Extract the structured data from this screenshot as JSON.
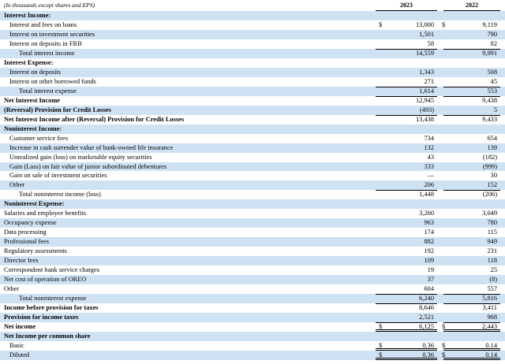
{
  "header": {
    "note": "(In thousands except shares and EPS)",
    "year_current": "2023",
    "year_prior": "2022"
  },
  "rows": [
    {
      "label": "Interest Income:",
      "v1": "",
      "v2": "",
      "indent": 0,
      "bold": true,
      "shade": true,
      "dollar": false,
      "top_rule": false,
      "bottom_rule": ""
    },
    {
      "label": "Interest and fees on loans",
      "v1": "13,000",
      "v2": "9,119",
      "indent": 1,
      "bold": false,
      "shade": false,
      "dollar": true,
      "top_rule": false,
      "bottom_rule": ""
    },
    {
      "label": "Interest on investment securities",
      "v1": "1,501",
      "v2": "790",
      "indent": 1,
      "bold": false,
      "shade": true,
      "dollar": false,
      "top_rule": false,
      "bottom_rule": ""
    },
    {
      "label": "Interest on deposits in FRB",
      "v1": "58",
      "v2": "82",
      "indent": 1,
      "bold": false,
      "shade": false,
      "dollar": false,
      "top_rule": false,
      "bottom_rule": ""
    },
    {
      "label": "Total interest income",
      "v1": "14,559",
      "v2": "9,991",
      "indent": 2,
      "bold": false,
      "shade": true,
      "dollar": false,
      "top_rule": true,
      "bottom_rule": ""
    },
    {
      "label": "Interest Expense:",
      "v1": "",
      "v2": "",
      "indent": 0,
      "bold": true,
      "shade": false,
      "dollar": false,
      "top_rule": false,
      "bottom_rule": ""
    },
    {
      "label": "Interest on deposits",
      "v1": "1,343",
      "v2": "508",
      "indent": 1,
      "bold": false,
      "shade": true,
      "dollar": false,
      "top_rule": false,
      "bottom_rule": ""
    },
    {
      "label": "Interest on other borrowed funds",
      "v1": "271",
      "v2": "45",
      "indent": 1,
      "bold": false,
      "shade": false,
      "dollar": false,
      "top_rule": false,
      "bottom_rule": ""
    },
    {
      "label": "Total interest expense",
      "v1": "1,614",
      "v2": "553",
      "indent": 2,
      "bold": false,
      "shade": true,
      "dollar": false,
      "top_rule": true,
      "bottom_rule": ""
    },
    {
      "label": "Net Interest Income",
      "v1": "12,945",
      "v2": "9,438",
      "indent": 0,
      "bold": true,
      "shade": false,
      "dollar": false,
      "top_rule": true,
      "bottom_rule": ""
    },
    {
      "label": "(Reversal) Provision for Credit Losses",
      "v1": "(493)",
      "v2": "5",
      "indent": 0,
      "bold": true,
      "shade": true,
      "dollar": false,
      "top_rule": false,
      "bottom_rule": ""
    },
    {
      "label": "Net Interest Income after (Reversal) Provision for Credit Losses",
      "v1": "13,438",
      "v2": "9,433",
      "indent": 0,
      "bold": true,
      "shade": false,
      "dollar": false,
      "top_rule": true,
      "bottom_rule": ""
    },
    {
      "label": "Noninterest Income:",
      "v1": "",
      "v2": "",
      "indent": 0,
      "bold": true,
      "shade": true,
      "dollar": false,
      "top_rule": false,
      "bottom_rule": ""
    },
    {
      "label": "Customer service fees",
      "v1": "734",
      "v2": "654",
      "indent": 1,
      "bold": false,
      "shade": false,
      "dollar": false,
      "top_rule": false,
      "bottom_rule": ""
    },
    {
      "label": "Increase in cash surrender value of bank-owned life insurance",
      "v1": "132",
      "v2": "139",
      "indent": 1,
      "bold": false,
      "shade": true,
      "dollar": false,
      "top_rule": false,
      "bottom_rule": ""
    },
    {
      "label": "Unrealized gain (loss) on marketable equity securities",
      "v1": "43",
      "v2": "(182)",
      "indent": 1,
      "bold": false,
      "shade": false,
      "dollar": false,
      "top_rule": false,
      "bottom_rule": ""
    },
    {
      "label": "Gain (Loss) on fair value of junior subordinated debentures",
      "v1": "333",
      "v2": "(999)",
      "indent": 1,
      "bold": false,
      "shade": true,
      "dollar": false,
      "top_rule": false,
      "bottom_rule": ""
    },
    {
      "label": "Gain on sale of investment securities",
      "v1": "—",
      "v2": "30",
      "indent": 1,
      "bold": false,
      "shade": false,
      "dollar": false,
      "top_rule": false,
      "bottom_rule": ""
    },
    {
      "label": "Other",
      "v1": "206",
      "v2": "152",
      "indent": 1,
      "bold": false,
      "shade": true,
      "dollar": false,
      "top_rule": false,
      "bottom_rule": ""
    },
    {
      "label": "Total noninterest income (loss)",
      "v1": "1,448",
      "v2": "(206)",
      "indent": 2,
      "bold": false,
      "shade": false,
      "dollar": false,
      "top_rule": true,
      "bottom_rule": ""
    },
    {
      "label": "Noninterest Expense:",
      "v1": "",
      "v2": "",
      "indent": 0,
      "bold": true,
      "shade": true,
      "dollar": false,
      "top_rule": false,
      "bottom_rule": ""
    },
    {
      "label": "Salaries and employee benefits",
      "v1": "3,260",
      "v2": "3,049",
      "indent": 0,
      "bold": false,
      "shade": false,
      "dollar": false,
      "top_rule": false,
      "bottom_rule": ""
    },
    {
      "label": "Occupancy expense",
      "v1": "963",
      "v2": "780",
      "indent": 0,
      "bold": false,
      "shade": true,
      "dollar": false,
      "top_rule": false,
      "bottom_rule": ""
    },
    {
      "label": "Data processing",
      "v1": "174",
      "v2": "115",
      "indent": 0,
      "bold": false,
      "shade": false,
      "dollar": false,
      "top_rule": false,
      "bottom_rule": ""
    },
    {
      "label": "Professional fees",
      "v1": "882",
      "v2": "949",
      "indent": 0,
      "bold": false,
      "shade": true,
      "dollar": false,
      "top_rule": false,
      "bottom_rule": ""
    },
    {
      "label": "Regulatory assessments",
      "v1": "192",
      "v2": "231",
      "indent": 0,
      "bold": false,
      "shade": false,
      "dollar": false,
      "top_rule": false,
      "bottom_rule": ""
    },
    {
      "label": "Director fees",
      "v1": "109",
      "v2": "118",
      "indent": 0,
      "bold": false,
      "shade": true,
      "dollar": false,
      "top_rule": false,
      "bottom_rule": ""
    },
    {
      "label": "Correspondent bank service charges",
      "v1": "19",
      "v2": "25",
      "indent": 0,
      "bold": false,
      "shade": false,
      "dollar": false,
      "top_rule": false,
      "bottom_rule": ""
    },
    {
      "label": "Net cost of operation of OREO",
      "v1": "37",
      "v2": "(8)",
      "indent": 0,
      "bold": false,
      "shade": true,
      "dollar": false,
      "top_rule": false,
      "bottom_rule": ""
    },
    {
      "label": "Other",
      "v1": "604",
      "v2": "557",
      "indent": 0,
      "bold": false,
      "shade": false,
      "dollar": false,
      "top_rule": false,
      "bottom_rule": ""
    },
    {
      "label": "Total noninterest expense",
      "v1": "6,240",
      "v2": "5,816",
      "indent": 2,
      "bold": false,
      "shade": true,
      "dollar": false,
      "top_rule": true,
      "bottom_rule": ""
    },
    {
      "label": "Income before provision for taxes",
      "v1": "8,646",
      "v2": "3,411",
      "indent": 0,
      "bold": true,
      "shade": false,
      "dollar": false,
      "top_rule": true,
      "bottom_rule": ""
    },
    {
      "label": "Provision for income taxes",
      "v1": "2,521",
      "v2": "968",
      "indent": 0,
      "bold": true,
      "shade": true,
      "dollar": false,
      "top_rule": false,
      "bottom_rule": ""
    },
    {
      "label": "Net income",
      "v1": "6,125",
      "v2": "2,443",
      "indent": 0,
      "bold": true,
      "shade": false,
      "dollar": true,
      "top_rule": true,
      "bottom_rule": "double"
    },
    {
      "label": "Net Income per common share",
      "v1": "",
      "v2": "",
      "indent": 0,
      "bold": true,
      "shade": true,
      "dollar": false,
      "top_rule": false,
      "bottom_rule": ""
    },
    {
      "label": "Basic",
      "v1": "0.36",
      "v2": "0.14",
      "indent": 1,
      "bold": false,
      "shade": false,
      "dollar": true,
      "top_rule": false,
      "bottom_rule": "double"
    },
    {
      "label": "Diluted",
      "v1": "0.36",
      "v2": "0.14",
      "indent": 1,
      "bold": false,
      "shade": true,
      "dollar": true,
      "top_rule": false,
      "bottom_rule": "double"
    }
  ],
  "currency_symbol": "$",
  "colors": {
    "shade": "#cfe2f3",
    "text": "#000000",
    "rule": "#000000"
  }
}
